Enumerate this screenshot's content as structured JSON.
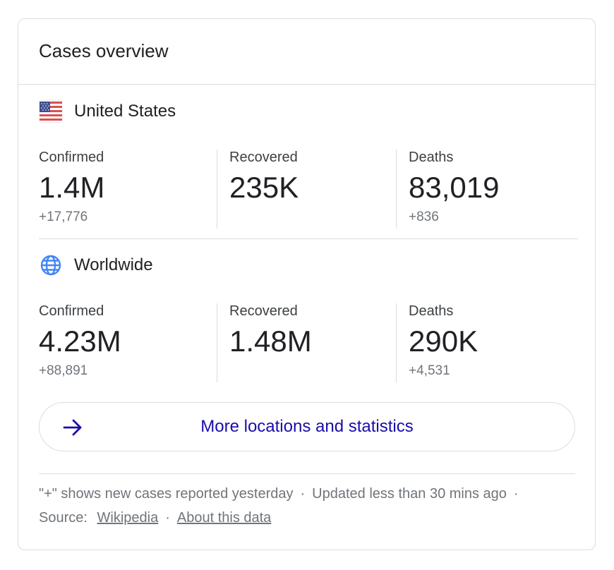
{
  "card": {
    "title": "Cases overview"
  },
  "us": {
    "name": "United States",
    "flag_icon": "us-flag-icon",
    "stats": [
      {
        "label": "Confirmed",
        "value": "1.4M",
        "delta": "+17,776"
      },
      {
        "label": "Recovered",
        "value": "235K",
        "delta": ""
      },
      {
        "label": "Deaths",
        "value": "83,019",
        "delta": "+836"
      }
    ]
  },
  "world": {
    "name": "Worldwide",
    "globe_icon": "globe-icon",
    "stats": [
      {
        "label": "Confirmed",
        "value": "4.23M",
        "delta": "+88,891"
      },
      {
        "label": "Recovered",
        "value": "1.48M",
        "delta": ""
      },
      {
        "label": "Deaths",
        "value": "290K",
        "delta": "+4,531"
      }
    ]
  },
  "more_button": {
    "label": "More locations and statistics",
    "icon": "arrow-right-icon"
  },
  "footer": {
    "note": "\"+\" shows new cases reported yesterday",
    "separator": "·",
    "updated": "Updated less than 30 mins ago",
    "source_label": "Source:",
    "source_link": "Wikipedia",
    "about_link": "About this data"
  },
  "colors": {
    "link_blue": "#1a0dab",
    "globe_blue": "#4285f4",
    "text_gray": "#70757a",
    "divider": "#dadce0"
  }
}
